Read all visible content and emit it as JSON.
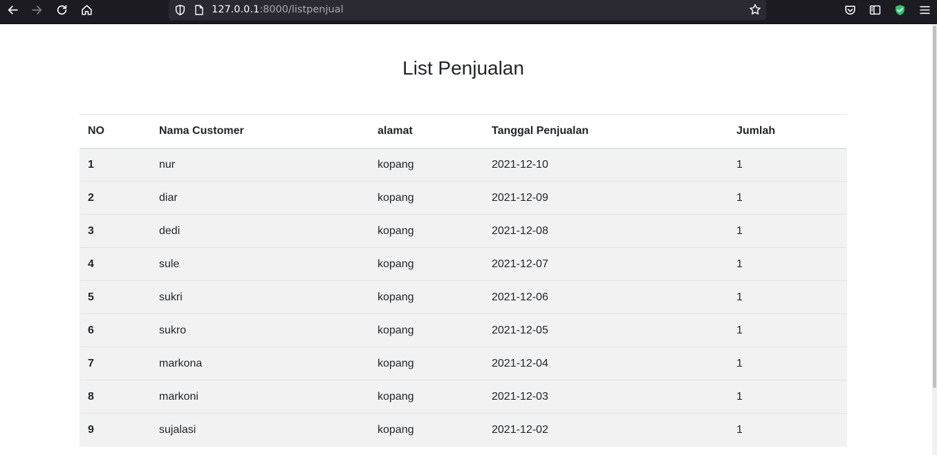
{
  "browser": {
    "url_host": "127.0.0.1",
    "url_rest": ":8000/listpenjual"
  },
  "page": {
    "title": "List Penjualan"
  },
  "table": {
    "headers": [
      "NO",
      "Nama Customer",
      "alamat",
      "Tanggal Penjualan",
      "Jumlah"
    ],
    "rows": [
      {
        "no": "1",
        "nama": "nur",
        "alamat": "kopang",
        "tanggal": "2021-12-10",
        "jumlah": "1"
      },
      {
        "no": "2",
        "nama": "diar",
        "alamat": "kopang",
        "tanggal": "2021-12-09",
        "jumlah": "1"
      },
      {
        "no": "3",
        "nama": "dedi",
        "alamat": "kopang",
        "tanggal": "2021-12-08",
        "jumlah": "1"
      },
      {
        "no": "4",
        "nama": "sule",
        "alamat": "kopang",
        "tanggal": "2021-12-07",
        "jumlah": "1"
      },
      {
        "no": "5",
        "nama": "sukri",
        "alamat": "kopang",
        "tanggal": "2021-12-06",
        "jumlah": "1"
      },
      {
        "no": "6",
        "nama": "sukro",
        "alamat": "kopang",
        "tanggal": "2021-12-05",
        "jumlah": "1"
      },
      {
        "no": "7",
        "nama": "markona",
        "alamat": "kopang",
        "tanggal": "2021-12-04",
        "jumlah": "1"
      },
      {
        "no": "8",
        "nama": "markoni",
        "alamat": "kopang",
        "tanggal": "2021-12-03",
        "jumlah": "1"
      },
      {
        "no": "9",
        "nama": "sujalasi",
        "alamat": "kopang",
        "tanggal": "2021-12-02",
        "jumlah": "1"
      }
    ]
  },
  "icons": {
    "back": "back-arrow-icon",
    "forward": "forward-arrow-icon",
    "reload": "reload-icon",
    "home": "home-icon",
    "tracking": "shield-icon",
    "page": "page-icon",
    "bookmark": "star-icon",
    "pocket": "pocket-icon",
    "sidebar": "sidebar-icon",
    "extension": "extension-shield-icon",
    "menu": "hamburger-menu-icon"
  },
  "colors": {
    "toolbar_bg": "#1c1b22",
    "urlbar_bg": "#2b2a33",
    "row_bg": "#f2f2f2",
    "border": "#dee2e6",
    "extension_green": "#2ac769"
  }
}
